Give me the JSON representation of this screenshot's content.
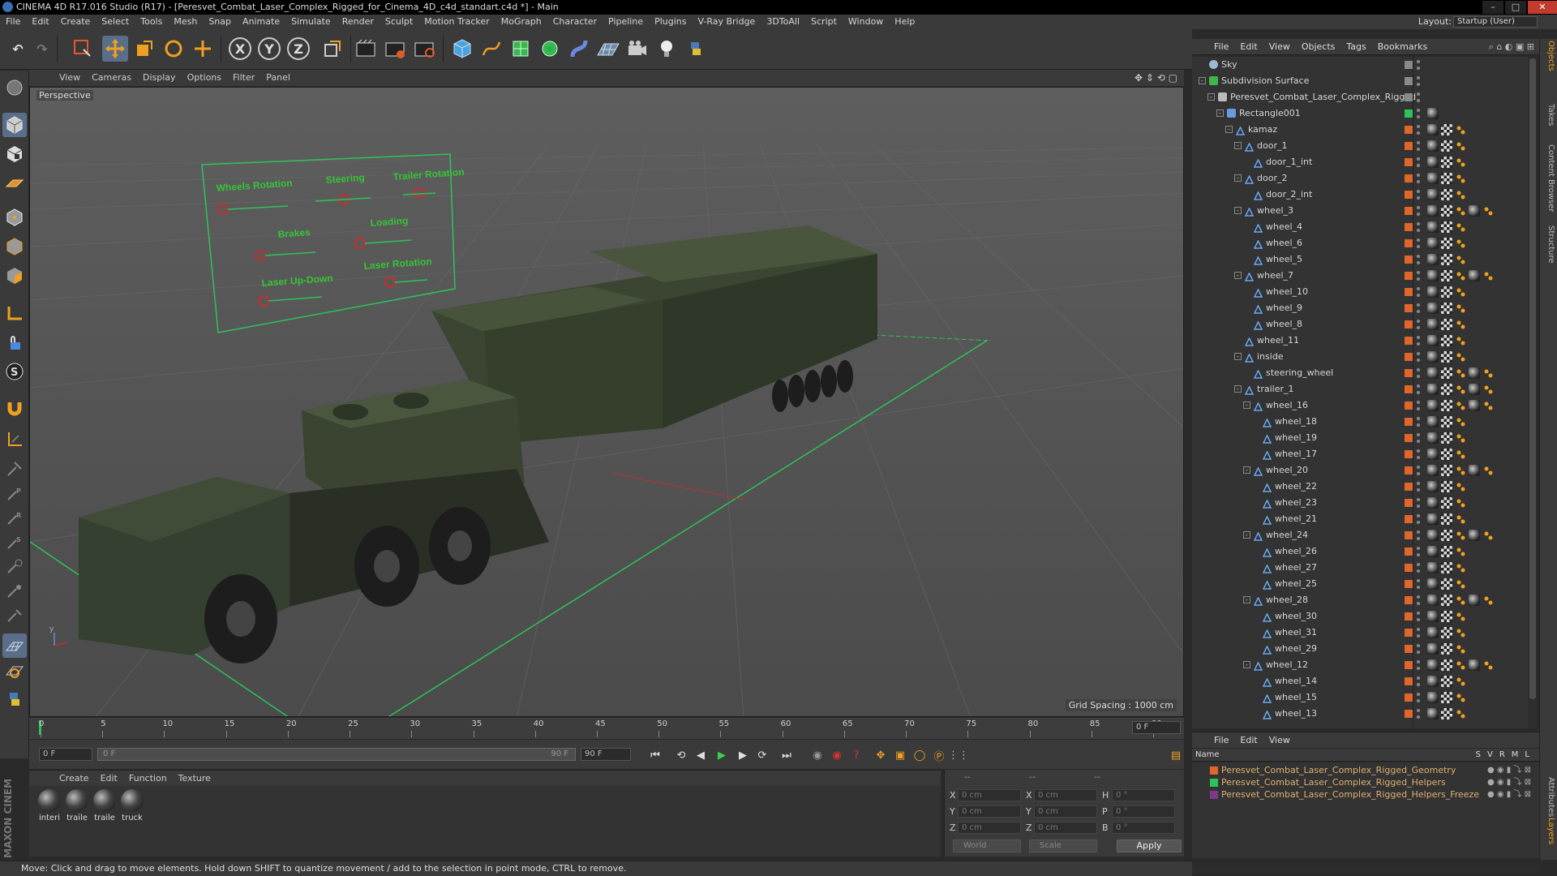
{
  "window": {
    "title": "CINEMA 4D R17.016 Studio (R17) - [Peresvet_Combat_Laser_Complex_Rigged_for_Cinema_4D_c4d_standart.c4d *] - Main",
    "minimize": "–",
    "maximize": "□",
    "close": "✕"
  },
  "menubar": {
    "items": [
      "File",
      "Edit",
      "Create",
      "Select",
      "Tools",
      "Mesh",
      "Snap",
      "Animate",
      "Simulate",
      "Render",
      "Sculpt",
      "Motion Tracker",
      "MoGraph",
      "Character",
      "Pipeline",
      "Plugins",
      "V-Ray Bridge",
      "3DToAll",
      "Script",
      "Window",
      "Help"
    ],
    "layout_label": "Layout:",
    "layout_value": "Startup (User)"
  },
  "toolbar": {
    "x_axis": "X",
    "y_axis": "Y",
    "z_axis": "Z"
  },
  "viewport": {
    "menu": [
      "View",
      "Cameras",
      "Display",
      "Options",
      "Filter",
      "Panel"
    ],
    "label": "Perspective",
    "grid_spacing": "Grid Spacing : 1000 cm",
    "hud_labels": [
      "Wheels Rotation",
      "Steering",
      "Trailer Rotation",
      "Brakes",
      "Loading",
      "Laser Up-Down",
      "Laser Rotation"
    ]
  },
  "timeline": {
    "ticks": [
      "0",
      "5",
      "10",
      "15",
      "20",
      "25",
      "30",
      "35",
      "40",
      "45",
      "50",
      "55",
      "60",
      "65",
      "70",
      "75",
      "80",
      "85",
      "90"
    ],
    "frame_field": "0 F"
  },
  "transport": {
    "current_frame": "0 F",
    "range_start": "0 F",
    "range_end": "90 F",
    "end_frame": "90 F"
  },
  "materials": {
    "menu": [
      "Create",
      "Edit",
      "Function",
      "Texture"
    ],
    "items": [
      {
        "label": "interi"
      },
      {
        "label": "traile"
      },
      {
        "label": "traile"
      },
      {
        "label": "truck"
      }
    ]
  },
  "coordinates": {
    "header_dashes": [
      "--",
      "--",
      "--"
    ],
    "rows": [
      {
        "a_label": "X",
        "a_value": "0 cm",
        "b_label": "X",
        "b_value": "0 cm",
        "c_label": "H",
        "c_value": "0 °"
      },
      {
        "a_label": "Y",
        "a_value": "0 cm",
        "b_label": "Y",
        "b_value": "0 cm",
        "c_label": "P",
        "c_value": "0 °"
      },
      {
        "a_label": "Z",
        "a_value": "0 cm",
        "b_label": "Z",
        "b_value": "0 cm",
        "c_label": "B",
        "c_value": "0 °"
      }
    ],
    "mode": "World",
    "mode2": "Scale",
    "apply": "Apply"
  },
  "statusbar": {
    "text": "Move: Click and drag to move elements. Hold down SHIFT to quantize movement / add to the selection in point mode, CTRL to remove."
  },
  "branding": "MAXON CINEMA 4D",
  "object_manager": {
    "menu": [
      "File",
      "Edit",
      "View",
      "Objects",
      "Tags",
      "Bookmarks"
    ],
    "objects": [
      {
        "name": "Sky",
        "depth": 0,
        "expand": "",
        "icon": "sky",
        "swatch": "#8a8a8a",
        "tags": 0
      },
      {
        "name": "Subdivision Surface",
        "depth": 0,
        "expand": "-",
        "icon": "subd",
        "swatch": "#8a8a8a",
        "tags": 0
      },
      {
        "name": "Peresvet_Combat_Laser_Complex_Rigged",
        "depth": 1,
        "expand": "-",
        "icon": "null",
        "swatch": "#8a8a8a",
        "tags": 0
      },
      {
        "name": "Rectangle001",
        "depth": 2,
        "expand": "-",
        "icon": "spline",
        "swatch": "#2fc25a",
        "tags": 1
      },
      {
        "name": "kamaz",
        "depth": 3,
        "expand": "-",
        "icon": "joint",
        "swatch": "#e0662b",
        "tags": 3
      },
      {
        "name": "door_1",
        "depth": 4,
        "expand": "-",
        "icon": "joint",
        "swatch": "#e0662b",
        "tags": 3
      },
      {
        "name": "door_1_int",
        "depth": 5,
        "expand": "",
        "icon": "joint",
        "swatch": "#e0662b",
        "tags": 3
      },
      {
        "name": "door_2",
        "depth": 4,
        "expand": "-",
        "icon": "joint",
        "swatch": "#e0662b",
        "tags": 3
      },
      {
        "name": "door_2_int",
        "depth": 5,
        "expand": "",
        "icon": "joint",
        "swatch": "#e0662b",
        "tags": 3
      },
      {
        "name": "wheel_3",
        "depth": 4,
        "expand": "-",
        "icon": "joint",
        "swatch": "#e0662b",
        "tags": 5
      },
      {
        "name": "wheel_4",
        "depth": 5,
        "expand": "",
        "icon": "joint",
        "swatch": "#e0662b",
        "tags": 3
      },
      {
        "name": "wheel_6",
        "depth": 5,
        "expand": "",
        "icon": "joint",
        "swatch": "#e0662b",
        "tags": 3
      },
      {
        "name": "wheel_5",
        "depth": 5,
        "expand": "",
        "icon": "joint",
        "swatch": "#e0662b",
        "tags": 3
      },
      {
        "name": "wheel_7",
        "depth": 4,
        "expand": "-",
        "icon": "joint",
        "swatch": "#e0662b",
        "tags": 5
      },
      {
        "name": "wheel_10",
        "depth": 5,
        "expand": "",
        "icon": "joint",
        "swatch": "#e0662b",
        "tags": 3
      },
      {
        "name": "wheel_9",
        "depth": 5,
        "expand": "",
        "icon": "joint",
        "swatch": "#e0662b",
        "tags": 3
      },
      {
        "name": "wheel_8",
        "depth": 5,
        "expand": "",
        "icon": "joint",
        "swatch": "#e0662b",
        "tags": 3
      },
      {
        "name": "wheel_11",
        "depth": 4,
        "expand": "",
        "icon": "joint",
        "swatch": "#e0662b",
        "tags": 3
      },
      {
        "name": "inside",
        "depth": 4,
        "expand": "-",
        "icon": "joint",
        "swatch": "#e0662b",
        "tags": 3
      },
      {
        "name": "steering_wheel",
        "depth": 5,
        "expand": "",
        "icon": "joint",
        "swatch": "#e0662b",
        "tags": 5
      },
      {
        "name": "trailer_1",
        "depth": 4,
        "expand": "-",
        "icon": "joint",
        "swatch": "#e0662b",
        "tags": 5
      },
      {
        "name": "wheel_16",
        "depth": 5,
        "expand": "-",
        "icon": "joint",
        "swatch": "#e0662b",
        "tags": 5
      },
      {
        "name": "wheel_18",
        "depth": 6,
        "expand": "",
        "icon": "joint",
        "swatch": "#e0662b",
        "tags": 3
      },
      {
        "name": "wheel_19",
        "depth": 6,
        "expand": "",
        "icon": "joint",
        "swatch": "#e0662b",
        "tags": 3
      },
      {
        "name": "wheel_17",
        "depth": 6,
        "expand": "",
        "icon": "joint",
        "swatch": "#e0662b",
        "tags": 3
      },
      {
        "name": "wheel_20",
        "depth": 5,
        "expand": "-",
        "icon": "joint",
        "swatch": "#e0662b",
        "tags": 5
      },
      {
        "name": "wheel_22",
        "depth": 6,
        "expand": "",
        "icon": "joint",
        "swatch": "#e0662b",
        "tags": 3
      },
      {
        "name": "wheel_23",
        "depth": 6,
        "expand": "",
        "icon": "joint",
        "swatch": "#e0662b",
        "tags": 3
      },
      {
        "name": "wheel_21",
        "depth": 6,
        "expand": "",
        "icon": "joint",
        "swatch": "#e0662b",
        "tags": 3
      },
      {
        "name": "wheel_24",
        "depth": 5,
        "expand": "-",
        "icon": "joint",
        "swatch": "#e0662b",
        "tags": 5
      },
      {
        "name": "wheel_26",
        "depth": 6,
        "expand": "",
        "icon": "joint",
        "swatch": "#e0662b",
        "tags": 3
      },
      {
        "name": "wheel_27",
        "depth": 6,
        "expand": "",
        "icon": "joint",
        "swatch": "#e0662b",
        "tags": 3
      },
      {
        "name": "wheel_25",
        "depth": 6,
        "expand": "",
        "icon": "joint",
        "swatch": "#e0662b",
        "tags": 3
      },
      {
        "name": "wheel_28",
        "depth": 5,
        "expand": "-",
        "icon": "joint",
        "swatch": "#e0662b",
        "tags": 5
      },
      {
        "name": "wheel_30",
        "depth": 6,
        "expand": "",
        "icon": "joint",
        "swatch": "#e0662b",
        "tags": 3
      },
      {
        "name": "wheel_31",
        "depth": 6,
        "expand": "",
        "icon": "joint",
        "swatch": "#e0662b",
        "tags": 3
      },
      {
        "name": "wheel_29",
        "depth": 6,
        "expand": "",
        "icon": "joint",
        "swatch": "#e0662b",
        "tags": 3
      },
      {
        "name": "wheel_12",
        "depth": 5,
        "expand": "-",
        "icon": "joint",
        "swatch": "#e0662b",
        "tags": 5
      },
      {
        "name": "wheel_14",
        "depth": 6,
        "expand": "",
        "icon": "joint",
        "swatch": "#e0662b",
        "tags": 3
      },
      {
        "name": "wheel_15",
        "depth": 6,
        "expand": "",
        "icon": "joint",
        "swatch": "#e0662b",
        "tags": 3
      },
      {
        "name": "wheel_13",
        "depth": 6,
        "expand": "",
        "icon": "joint",
        "swatch": "#e0662b",
        "tags": 3
      }
    ]
  },
  "layer_manager": {
    "menu": [
      "File",
      "Edit",
      "View"
    ],
    "header_name": "Name",
    "header_flags": [
      "S",
      "V",
      "R",
      "M",
      "L"
    ],
    "layers": [
      {
        "name": "Peresvet_Combat_Laser_Complex_Rigged_Geometry",
        "color": "#e0662b"
      },
      {
        "name": "Peresvet_Combat_Laser_Complex_Rigged_Helpers",
        "color": "#2fc25a"
      },
      {
        "name": "Peresvet_Combat_Laser_Complex_Rigged_Helpers_Freeze",
        "color": "#7b3a8e"
      }
    ]
  },
  "side_tabs": [
    "Objects",
    "Takes",
    "Content Browser",
    "Structure",
    "Attributes",
    "Layers"
  ]
}
